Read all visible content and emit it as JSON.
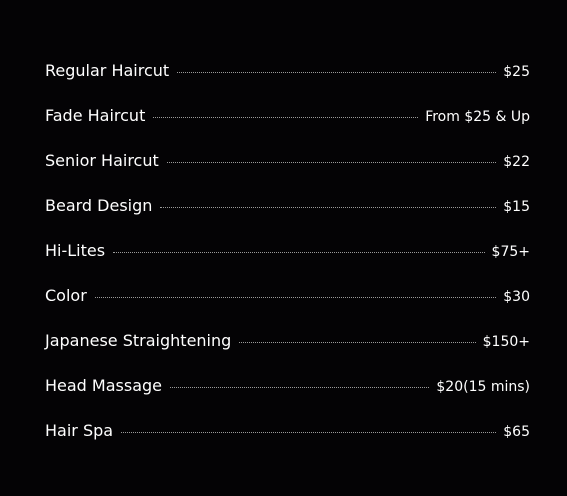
{
  "price_list": {
    "items": [
      {
        "name": "Regular Haircut",
        "price": "$25"
      },
      {
        "name": "Fade Haircut",
        "price": "From $25 & Up"
      },
      {
        "name": "Senior Haircut",
        "price": "$22"
      },
      {
        "name": "Beard Design",
        "price": "$15"
      },
      {
        "name": "Hi-Lites",
        "price": "$75+"
      },
      {
        "name": "Color",
        "price": "$30"
      },
      {
        "name": "Japanese Straightening",
        "price": "$150+"
      },
      {
        "name": "Head Massage",
        "price": "$20(15 mins)"
      },
      {
        "name": "Hair Spa",
        "price": "$65"
      }
    ]
  },
  "colors": {
    "background": "#040305",
    "text": "#ffffff",
    "leader_dots": "#9a9a9a"
  }
}
